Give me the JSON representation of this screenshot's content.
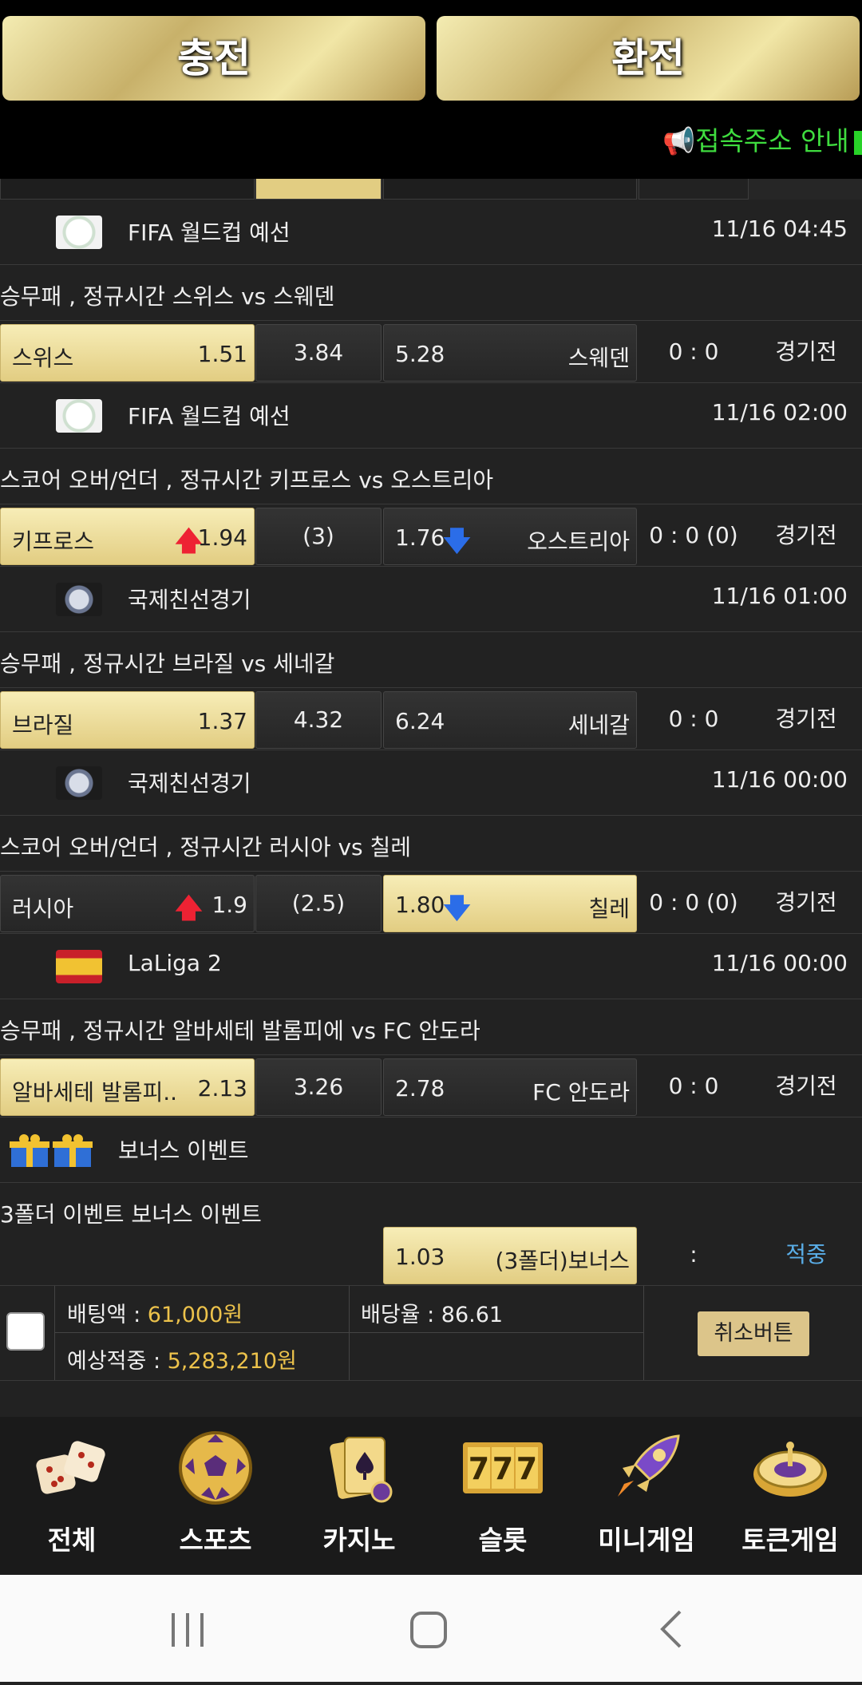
{
  "header": {
    "charge_label": "충전",
    "exchange_label": "환전",
    "notice": "📢접속주소 안내"
  },
  "matches": [
    {
      "league": "FIFA 월드컵 예선",
      "time": "11/16 04:45",
      "market": "승무패 , 정규시간 스위스  vs  스웨덴",
      "home": "스위스",
      "home_odds": "1.51",
      "draw": "3.84",
      "away_odds": "5.28",
      "away": "스웨덴",
      "score": "0 : 0",
      "status": "경기전"
    },
    {
      "league": "FIFA 월드컵 예선",
      "time": "11/16 02:00",
      "market": "스코어 오버/언더 , 정규시간 키프로스  vs  오스트리아",
      "home": "키프로스",
      "home_odds": "1.94",
      "draw": "(3)",
      "away_odds": "1.76",
      "away": "오스트리아",
      "score": "0 : 0 (0)",
      "status": "경기전"
    },
    {
      "league": "국제친선경기",
      "time": "11/16 01:00",
      "market": "승무패 , 정규시간 브라질  vs  세네갈",
      "home": "브라질",
      "home_odds": "1.37",
      "draw": "4.32",
      "away_odds": "6.24",
      "away": "세네갈",
      "score": "0 : 0",
      "status": "경기전"
    },
    {
      "league": "국제친선경기",
      "time": "11/16 00:00",
      "market": "스코어 오버/언더 , 정규시간 러시아  vs  칠레",
      "home": "러시아",
      "home_odds": "1.9",
      "draw": "(2.5)",
      "away_odds": "1.80",
      "away": "칠레",
      "score": "0 : 0 (0)",
      "status": "경기전"
    },
    {
      "league": "LaLiga 2",
      "time": "11/16 00:00",
      "market": "승무패 , 정규시간 알바세테 발롬피에  vs  FC 안도라",
      "home": "알바세테 발롬피..",
      "home_odds": "2.13",
      "draw": "3.26",
      "away_odds": "2.78",
      "away": "FC 안도라",
      "score": "0 : 0",
      "status": "경기전"
    }
  ],
  "bonus": {
    "league": "보너스 이벤트",
    "market": "3폴더 이벤트 보너스 이벤트",
    "odds": "1.03",
    "label": "(3폴더)보너스",
    "score": ":",
    "status": "적중"
  },
  "slip": {
    "bet_label": "배팅액 : ",
    "bet_value": "61,000원",
    "rate_label": "배당율 : ",
    "rate_value": "86.61",
    "expected_label": "예상적중 : ",
    "expected_value": "5,283,210원",
    "cancel_label": "취소버튼"
  },
  "nav": [
    "전체",
    "스포츠",
    "카지노",
    "슬롯",
    "미니게임",
    "토큰게임"
  ],
  "colors": {
    "gold": "#e2cd82",
    "amount": "#ecc24b",
    "notice": "#3fdc3f",
    "hit": "#5aaee8"
  }
}
